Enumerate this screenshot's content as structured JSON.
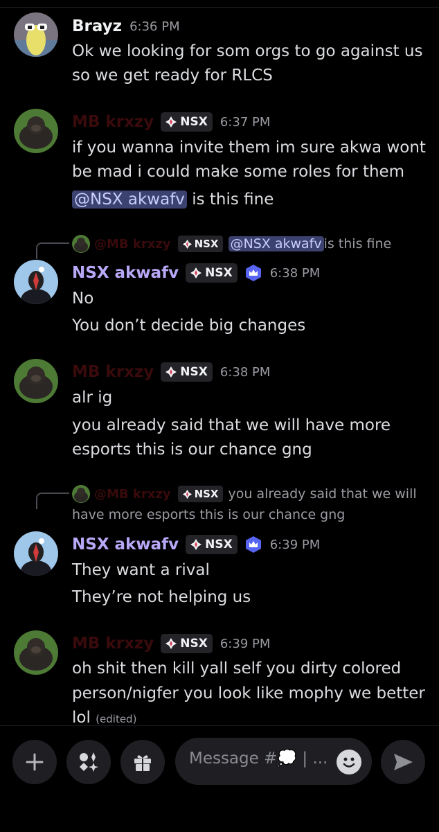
{
  "messages": [
    {
      "author": "Brayz",
      "time": "6:36 PM",
      "lines": [
        "Ok we looking for som orgs to go against us",
        "so we get ready for RLCS"
      ]
    },
    {
      "author": "MB krxzy",
      "tag": "NSX",
      "time": "6:37 PM",
      "lines": [
        "if you wanna invite them im sure akwa wont",
        "be mad i could make some roles for them"
      ],
      "mention": "@NSX akwafv",
      "mention_suffix": " is this fine"
    },
    {
      "reply": {
        "author": "@MB krxzy",
        "tag": "NSX",
        "mention": "@NSX akwafv",
        "text": " is this fine"
      },
      "author": "NSX akwafv",
      "tag": "NSX",
      "time": "6:38 PM",
      "lines": [
        "No",
        "You don’t decide big changes"
      ]
    },
    {
      "author": "MB krxzy",
      "tag": "NSX",
      "time": "6:38 PM",
      "lines": [
        "alr ig",
        "you already said that we will have more",
        "esports this is our chance gng"
      ]
    },
    {
      "reply": {
        "author": "@MB krxzy",
        "tag": "NSX",
        "text": "you already said that we will",
        "text2": "have more esports this is our chance gng"
      },
      "author": "NSX akwafv",
      "tag": "NSX",
      "time": "6:39 PM",
      "lines": [
        "They want a rival",
        "They’re not helping us"
      ]
    },
    {
      "author": "MB krxzy",
      "tag": "NSX",
      "time": "6:39 PM",
      "lines": [
        "oh shit then kill yall self you dirty colored",
        "person/nigfer you look like mophy we better",
        "lol"
      ],
      "edited": "(edited)"
    }
  ],
  "composer": {
    "placeholder": "Message #💭 | ..."
  },
  "colors": {
    "background": "#000000",
    "purple_name": "#b9a8f7",
    "mention_bg": "#3c4270",
    "red_name": "#3a0a0c"
  },
  "icons": [
    "plus-icon",
    "apps-icon",
    "gift-icon",
    "emoji-icon",
    "send-icon",
    "nsx-tag-icon",
    "crown-badge-icon"
  ]
}
